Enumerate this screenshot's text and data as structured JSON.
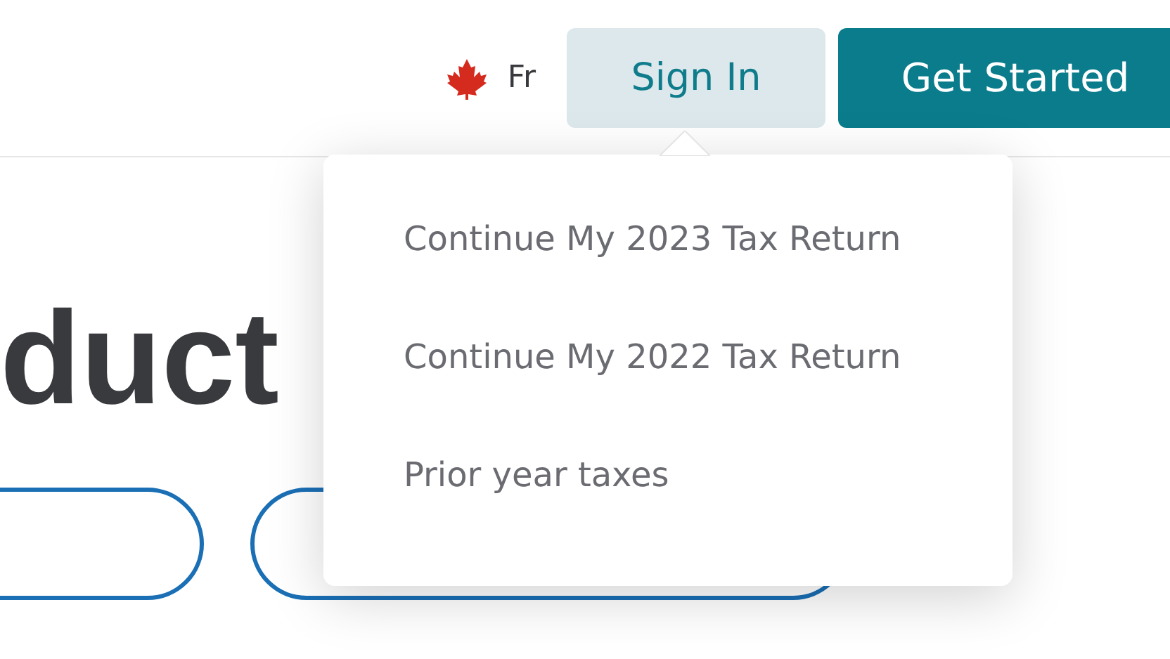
{
  "header": {
    "language_link": "Fr",
    "sign_in_button": {
      "label": "Sign In",
      "expanded": true
    },
    "get_started_button": "Get Started"
  },
  "sign_in_menu": [
    {
      "label": "Continue My 2023 Tax Return"
    },
    {
      "label": "Continue My 2022 Tax Return"
    },
    {
      "label": "Prior year taxes"
    }
  ],
  "hero": {
    "heading": "duct"
  }
}
